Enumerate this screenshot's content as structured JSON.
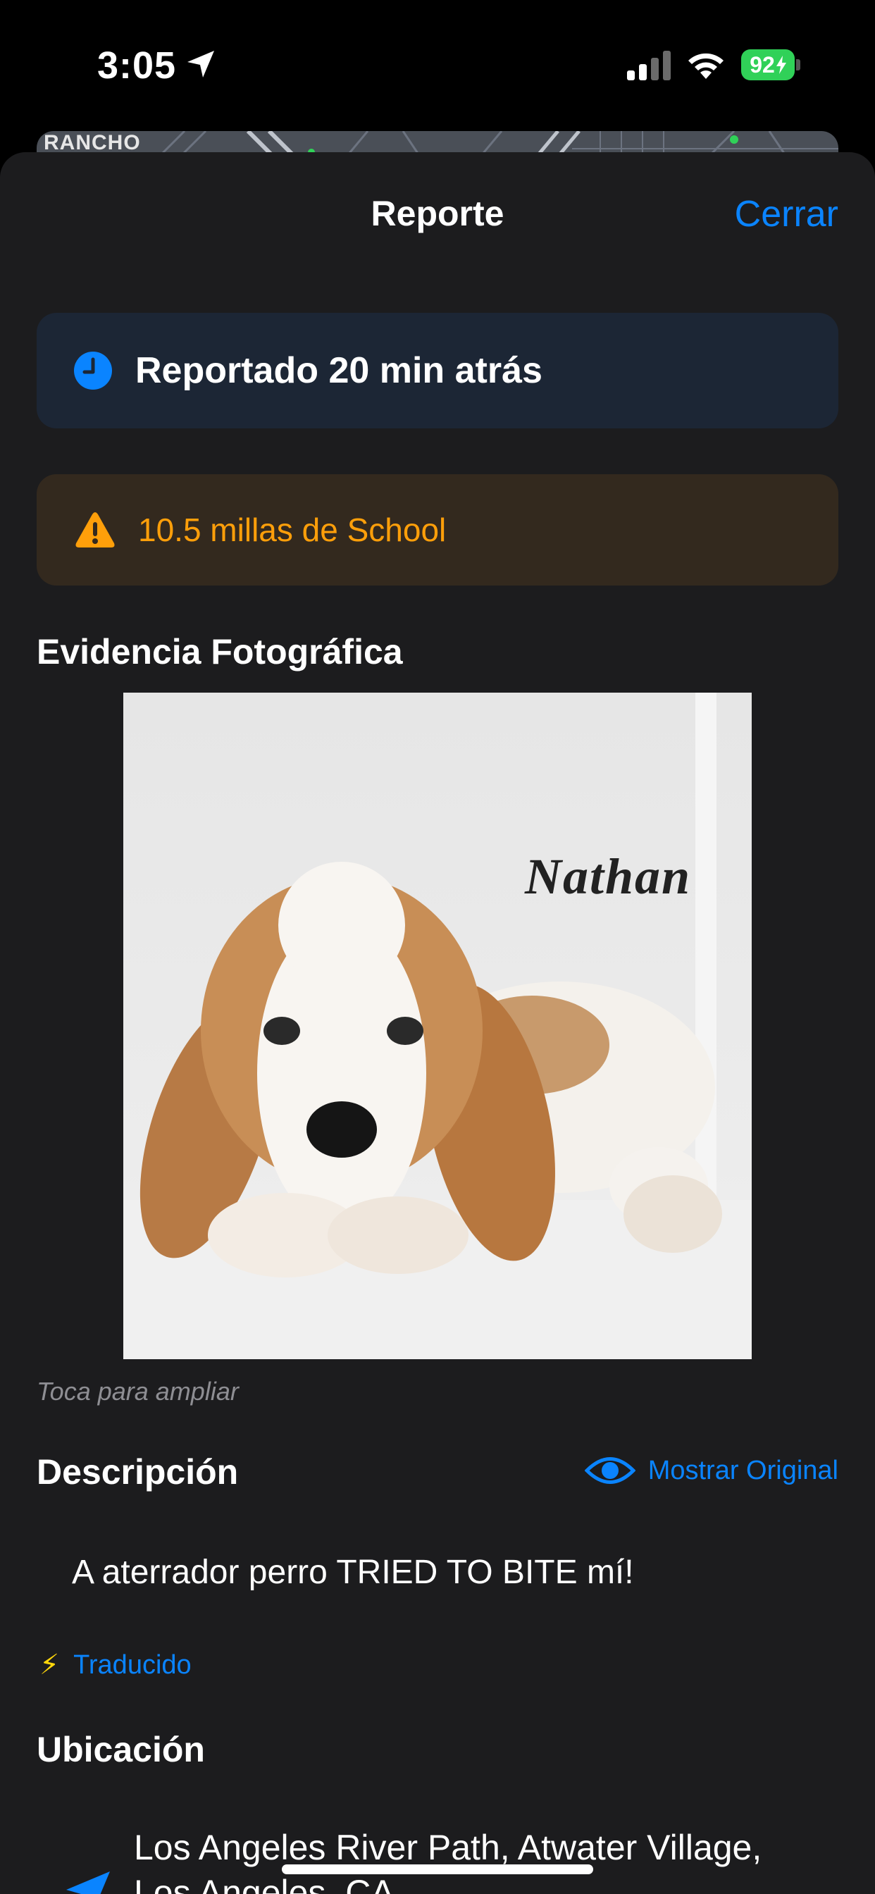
{
  "status_bar": {
    "time": "3:05",
    "battery": "92",
    "colors": {
      "battery_fill": "#30d158"
    }
  },
  "map": {
    "label": "RANCHO"
  },
  "sheet": {
    "title": "Reporte",
    "close_label": "Cerrar"
  },
  "reported_card": {
    "icon": "clock-icon",
    "text": "Reportado 20 min atrás"
  },
  "distance_card": {
    "icon": "warning-triangle-icon",
    "text": "10.5 millas de School",
    "color": "#ff9f0a"
  },
  "photo_section": {
    "title": "Evidencia Fotográfica",
    "photo_text": "Nathan",
    "caption": "Toca para ampliar"
  },
  "description_section": {
    "title": "Descripción",
    "show_original_label": "Mostrar Original",
    "text": "A aterrador perro TRIED TO BITE mí!",
    "translated_label": "Traducido"
  },
  "location_section": {
    "title": "Ubicación",
    "address": "Los Angeles River Path, Atwater Village, Los Angeles, CA"
  },
  "colors": {
    "accent": "#0a84ff",
    "sheet_bg": "#1c1c1e",
    "warning": "#ff9f0a"
  }
}
